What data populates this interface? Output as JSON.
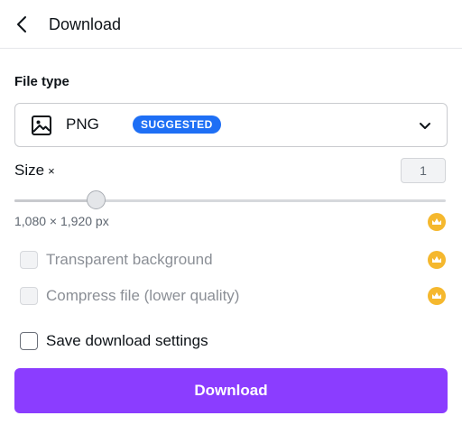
{
  "header": {
    "title": "Download"
  },
  "file_type": {
    "label": "File type",
    "value": "PNG",
    "badge": "SUGGESTED"
  },
  "size": {
    "label": "Size",
    "multiplier_symbol": "×",
    "value": "1",
    "slider_fraction": 0.19,
    "dimensions": "1,080 × 1,920 px"
  },
  "options": {
    "transparent_background": {
      "label": "Transparent background",
      "checked": false,
      "disabled": true
    },
    "compress_file": {
      "label": "Compress file (lower quality)",
      "checked": false,
      "disabled": true
    },
    "save_settings": {
      "label": "Save download settings",
      "checked": false,
      "disabled": false
    }
  },
  "download_button": {
    "label": "Download"
  },
  "colors": {
    "accent": "#8b3dff",
    "badge": "#1e6ff5",
    "crown": "#f5b82e"
  },
  "icons": {
    "back": "chevron-left-icon",
    "file_type": "image-icon",
    "dropdown": "chevron-down-icon",
    "premium": "crown-icon"
  }
}
